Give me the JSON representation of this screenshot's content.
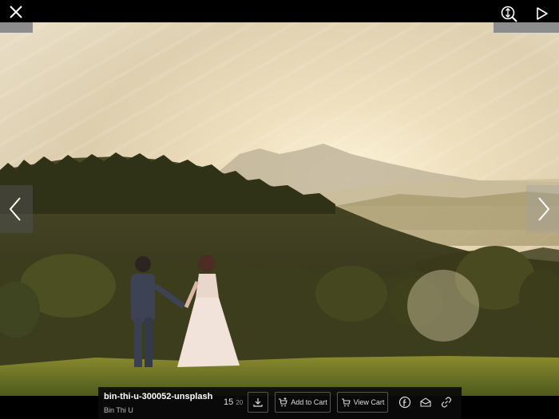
{
  "toolbar": {
    "close_icon": "close-icon",
    "zoom_icon": "zoom-icon",
    "play_icon": "play-icon"
  },
  "navigation": {
    "prev_icon": "chevron-left-icon",
    "next_icon": "chevron-right-icon"
  },
  "image": {
    "filename": "bin-thi-u-300052-unsplash",
    "author": "Bin Thi U",
    "index": "15",
    "total": "20"
  },
  "actions": {
    "download_icon": "download-icon",
    "add_to_cart_label": "Add to Cart",
    "view_cart_label": "View Cart",
    "facebook_icon": "facebook-icon",
    "email_icon": "mail-icon",
    "link_icon": "link-icon"
  }
}
